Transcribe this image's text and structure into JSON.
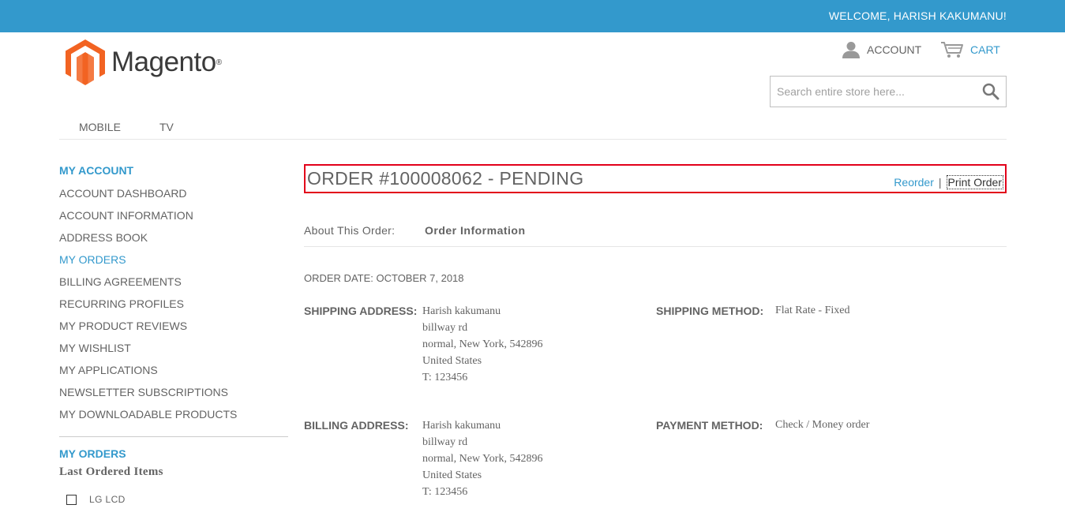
{
  "colors": {
    "brand_blue": "#3399cc",
    "highlight_red": "#e2001a",
    "text": "#636363",
    "logo_orange": "#f26322"
  },
  "topbar": {
    "welcome": "WELCOME, HARISH KAKUMANU!"
  },
  "header": {
    "logo_text": "Magento",
    "logo_mark": "®",
    "account_label": "ACCOUNT",
    "account_icon": "user-icon",
    "cart_label": "CART",
    "cart_icon": "cart-icon",
    "search": {
      "placeholder": "Search entire store here...",
      "value": "",
      "icon": "search-icon"
    }
  },
  "nav": {
    "items": [
      {
        "label": "MOBILE"
      },
      {
        "label": "TV"
      }
    ]
  },
  "sidebar": {
    "title": "MY ACCOUNT",
    "items": [
      {
        "label": "ACCOUNT DASHBOARD",
        "active": false
      },
      {
        "label": "ACCOUNT INFORMATION",
        "active": false
      },
      {
        "label": "ADDRESS BOOK",
        "active": false
      },
      {
        "label": "MY ORDERS",
        "active": true
      },
      {
        "label": "BILLING AGREEMENTS",
        "active": false
      },
      {
        "label": "RECURRING PROFILES",
        "active": false
      },
      {
        "label": "MY PRODUCT REVIEWS",
        "active": false
      },
      {
        "label": "MY WISHLIST",
        "active": false
      },
      {
        "label": "MY APPLICATIONS",
        "active": false
      },
      {
        "label": "NEWSLETTER SUBSCRIPTIONS",
        "active": false
      },
      {
        "label": "MY DOWNLOADABLE PRODUCTS",
        "active": false
      }
    ],
    "orders_title": "MY ORDERS",
    "last_ordered_title": "Last Ordered Items",
    "last_ordered_items": [
      {
        "label": "LG LCD",
        "checked": false
      }
    ]
  },
  "order": {
    "title": "ORDER #100008062 - PENDING",
    "reorder_label": "Reorder",
    "separator": "|",
    "print_label": "Print Order",
    "about_label": "About This Order:",
    "about_tab": "Order Information",
    "date": "ORDER DATE: OCTOBER 7, 2018",
    "shipping_address_label": "SHIPPING ADDRESS:",
    "shipping_address": [
      "Harish kakumanu",
      "billway rd",
      "normal, New York, 542896",
      "United States",
      "T: 123456"
    ],
    "shipping_method_label": "SHIPPING METHOD:",
    "shipping_method": "Flat Rate - Fixed",
    "billing_address_label": "BILLING ADDRESS:",
    "billing_address": [
      "Harish kakumanu",
      "billway rd",
      "normal, New York, 542896",
      "United States",
      "T: 123456"
    ],
    "payment_method_label": "PAYMENT METHOD:",
    "payment_method": "Check / Money order"
  }
}
